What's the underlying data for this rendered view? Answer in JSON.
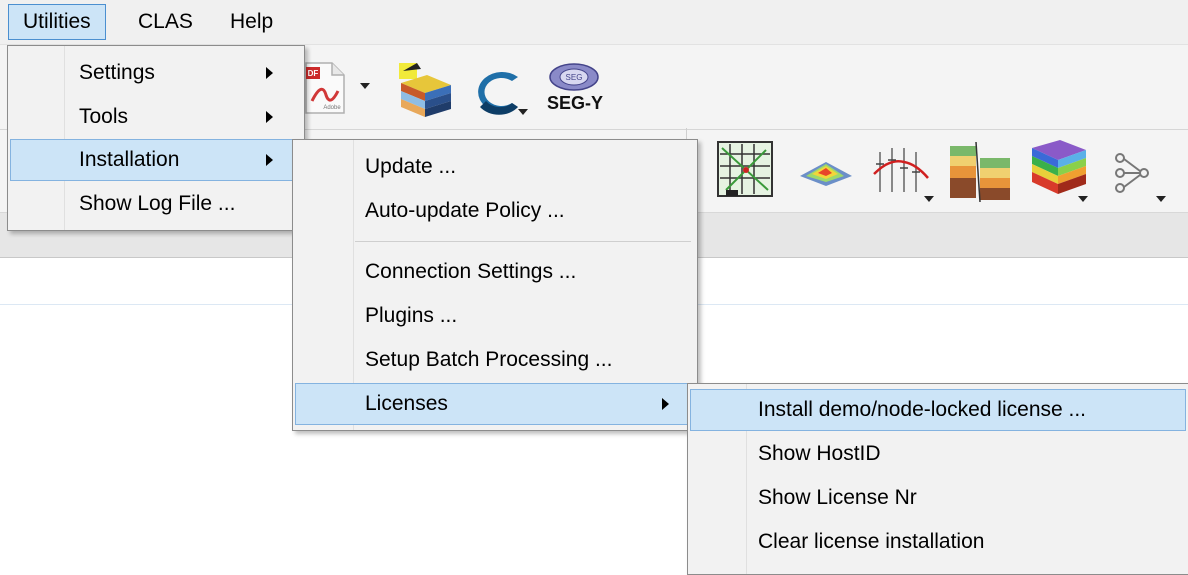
{
  "menubar": {
    "items": [
      {
        "label": "Utilities",
        "active": true
      },
      {
        "label": "CLAS",
        "active": false
      },
      {
        "label": "Help",
        "active": false
      }
    ]
  },
  "toolbar": {
    "segy_label": "SEG-Y",
    "pdf_badge": "Adobe",
    "icons": [
      "pdf-icon",
      "horizon-stack-icon",
      "c-logo-icon",
      "segy-icon",
      "grid-map-icon",
      "surface-icon",
      "well-correlation-icon",
      "fault-block-icon",
      "layer-cake-icon",
      "workflow-icon"
    ]
  },
  "utilities_menu": {
    "items": [
      {
        "label": "Settings",
        "submenu": true
      },
      {
        "label": "Tools",
        "submenu": true
      },
      {
        "label": "Installation",
        "submenu": true,
        "highlighted": true
      },
      {
        "label": "Show Log File ...",
        "submenu": false
      }
    ]
  },
  "installation_menu": {
    "items": [
      {
        "label": "Update ...",
        "submenu": false
      },
      {
        "label": "Auto-update Policy ...",
        "submenu": false
      },
      {
        "label": "Connection Settings ...",
        "submenu": false
      },
      {
        "label": "Plugins ...",
        "submenu": false
      },
      {
        "label": "Setup Batch Processing ...",
        "submenu": false
      },
      {
        "label": "Licenses",
        "submenu": true,
        "highlighted": true
      }
    ]
  },
  "licenses_menu": {
    "items": [
      {
        "label": "Install demo/node-locked license ...",
        "highlighted": true
      },
      {
        "label": "Show HostID"
      },
      {
        "label": "Show License Nr"
      },
      {
        "label": "Clear license installation"
      }
    ]
  },
  "colors": {
    "highlight": "#cce4f7",
    "highlight_border": "#84b3e0",
    "menu_bg": "#f2f2f2"
  }
}
